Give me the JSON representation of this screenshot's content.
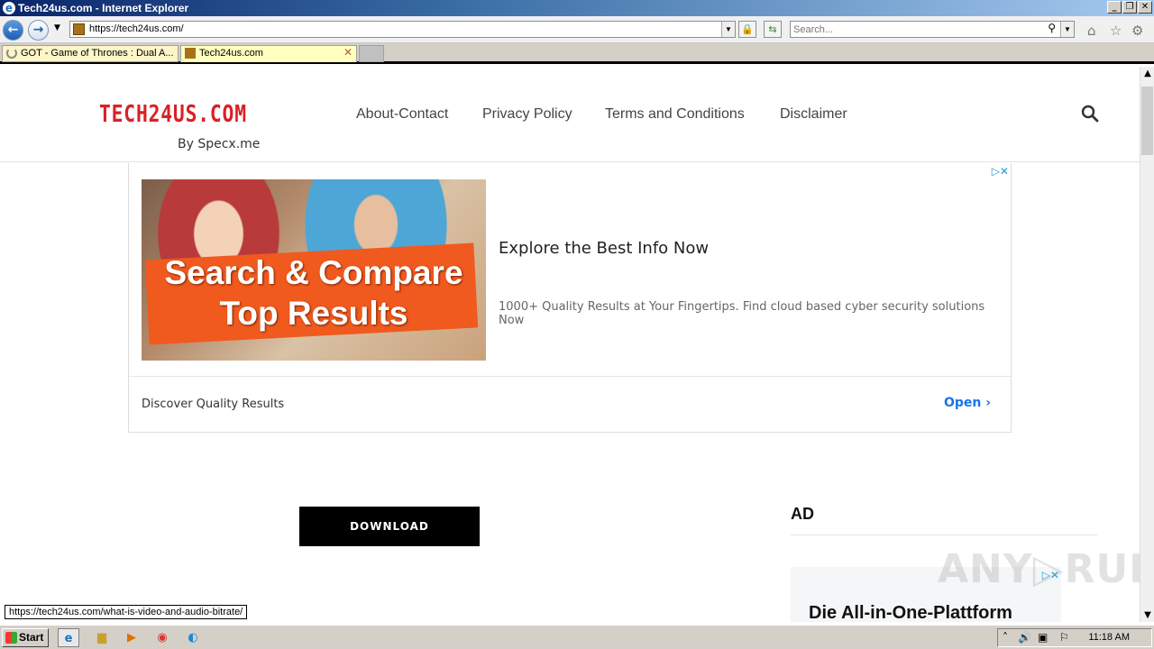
{
  "window": {
    "title": "Tech24us.com - Internet Explorer",
    "controls": [
      "_",
      "❐",
      "✕"
    ]
  },
  "browser": {
    "address": "https://tech24us.com/",
    "search_placeholder": "Search...",
    "tabs": [
      {
        "label": "GOT - Game of Thrones : Dual A...",
        "state": "loading"
      },
      {
        "label": "Tech24us.com",
        "state": "active"
      }
    ]
  },
  "site": {
    "logo": "TECH24US.COM",
    "logo_sub": "By Specx.me",
    "logo_color": "#d92026",
    "menu": [
      "About-Contact",
      "Privacy Policy",
      "Terms and Conditions",
      "Disclaimer"
    ]
  },
  "ad1": {
    "image_line1": "Search & Compare",
    "image_line2": "Top Results",
    "headline": "Explore the Best Info Now",
    "description": "1000+ Quality Results at Your Fingertips. Find cloud based cyber security solutions Now",
    "footer": "Discover Quality Results",
    "open": "Open",
    "open_arrow": "›"
  },
  "main": {
    "download": "DOWNLOAD"
  },
  "sidebar": {
    "ad_label": "AD",
    "ad2_headline": "Die All-in-One-Plattform"
  },
  "status_url": "https://tech24us.com/what-is-video-and-audio-bitrate/",
  "watermark": "ANY▷RUN",
  "taskbar": {
    "start": "Start",
    "clock": "11:18 AM"
  }
}
